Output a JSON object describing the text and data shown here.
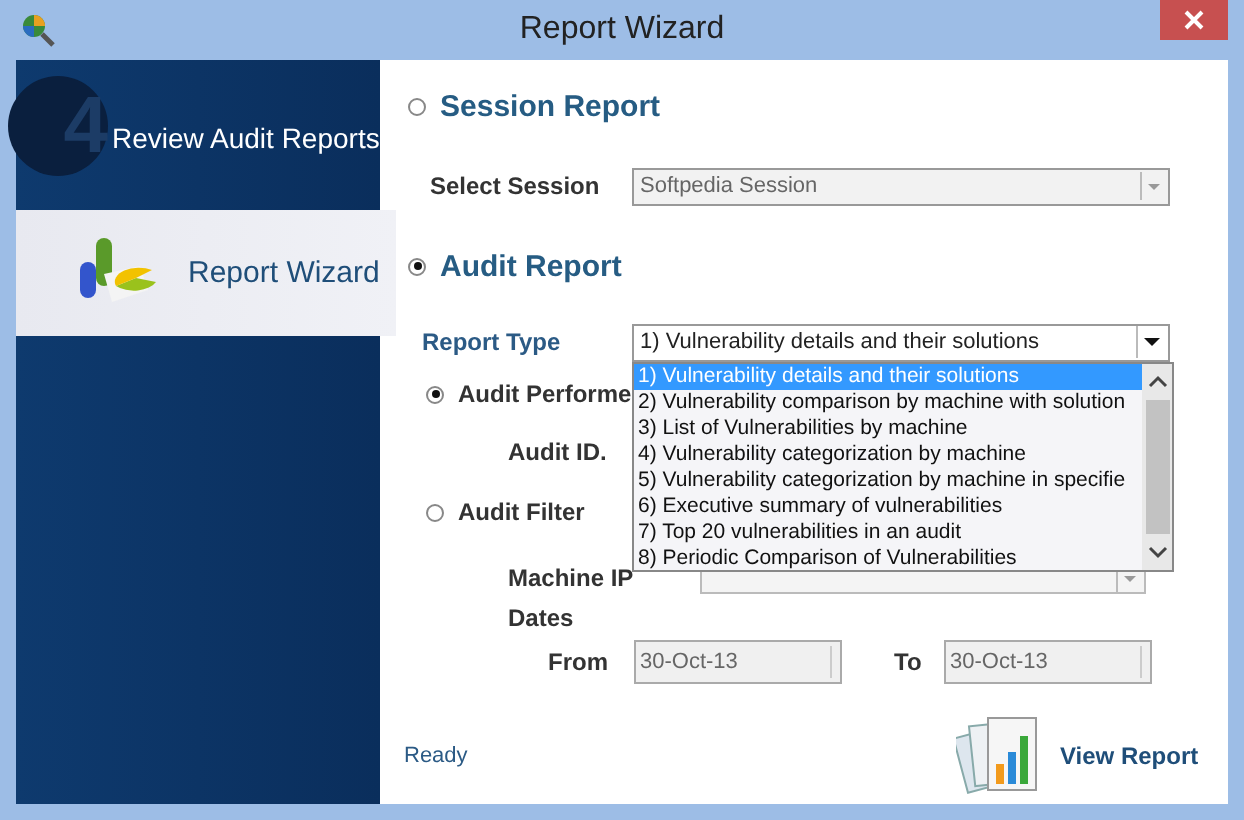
{
  "window": {
    "title": "Report Wizard"
  },
  "sidebar": {
    "step": "4",
    "header": "Review Audit Reports",
    "items": [
      {
        "label": "Report Wizard",
        "selected": true
      }
    ]
  },
  "session_report": {
    "label": "Session Report",
    "selected": false
  },
  "select_session": {
    "label": "Select Session",
    "value": "Softpedia Session",
    "disabled": true
  },
  "audit_report": {
    "label": "Audit Report",
    "selected": true
  },
  "report_type": {
    "label": "Report Type",
    "value": "1)  Vulnerability details and their solutions",
    "open": true,
    "options": [
      {
        "label": "1)  Vulnerability details and their solutions",
        "selected": true
      },
      {
        "label": "2)  Vulnerability comparison by machine with solution",
        "selected": false
      },
      {
        "label": "3)  List of Vulnerabilities by machine",
        "selected": false
      },
      {
        "label": "4)  Vulnerability categorization by machine",
        "selected": false
      },
      {
        "label": "5)  Vulnerability categorization by machine in specifie",
        "selected": false
      },
      {
        "label": "6)  Executive summary of vulnerabilities",
        "selected": false
      },
      {
        "label": "7) Top 20 vulnerabilities in an audit",
        "selected": false
      },
      {
        "label": "8) Periodic Comparison  of Vulnerabilities",
        "selected": false
      }
    ]
  },
  "audit_performed": {
    "label": "Audit Performe",
    "selected": true
  },
  "audit_id": {
    "label": "Audit ID."
  },
  "audit_filter": {
    "label": "Audit Filter",
    "selected": false
  },
  "machine_ip": {
    "label": "Machine IP"
  },
  "dates": {
    "label": "Dates"
  },
  "from": {
    "label": "From",
    "value": "30-Oct-13"
  },
  "to": {
    "label": "To",
    "value": "30-Oct-13"
  },
  "status": "Ready",
  "view_report": "View Report"
}
